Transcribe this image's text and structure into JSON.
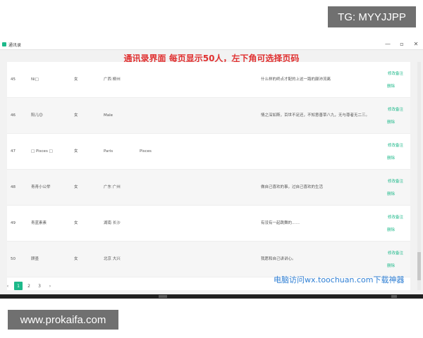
{
  "overlays": {
    "top_right_badge": "TG: MYYJJPP",
    "bottom_left_badge": "www.prokaifa.com",
    "blue_watermark": "电脑访问wx.toochuan.com下载神器"
  },
  "window": {
    "title": "通讯录",
    "controls": {
      "minimize": "—",
      "maximize": "▫",
      "close": "✕"
    }
  },
  "banner": "通讯录界面 每页显示50人，左下角可选择页码",
  "contacts": [
    {
      "id": "45",
      "name": "Ni□",
      "gender": "女",
      "region": "广西 柳州",
      "extra": "",
      "signature": "什么样的终点才配的上这一路的颠沛流离",
      "edit": "修改备注",
      "delete": "删除"
    },
    {
      "id": "46",
      "name": "阳儿😊",
      "gender": "女",
      "region": "Male",
      "extra": "",
      "signature": "情之深如斯，百世不足还，不知意善草八九，无与尊者无二三。",
      "edit": "修改备注",
      "delete": "删除"
    },
    {
      "id": "47",
      "name": "□ Pisces □",
      "gender": "女",
      "region": "Paris",
      "extra": "Pisces",
      "signature": "",
      "edit": "修改备注",
      "delete": "删除"
    },
    {
      "id": "48",
      "name": "青青小公举",
      "gender": "女",
      "region": "广东 广州",
      "extra": "",
      "signature": "做自己喜欢的事，过自己喜欢的生活",
      "edit": "修改备注",
      "delete": "删除"
    },
    {
      "id": "49",
      "name": "青蓝素素",
      "gender": "女",
      "region": "湖南 长沙",
      "extra": "",
      "signature": "有没有一起跳舞的……",
      "edit": "修改备注",
      "delete": "删除"
    },
    {
      "id": "50",
      "name": "顾墨",
      "gender": "女",
      "region": "北京 大兴",
      "extra": "",
      "signature": "我愿和自己讲讲心。",
      "edit": "修改备注",
      "delete": "删除"
    }
  ],
  "pagination": {
    "prev": "‹",
    "pages": [
      "1",
      "2",
      "3"
    ],
    "current": "1",
    "next": "›"
  }
}
